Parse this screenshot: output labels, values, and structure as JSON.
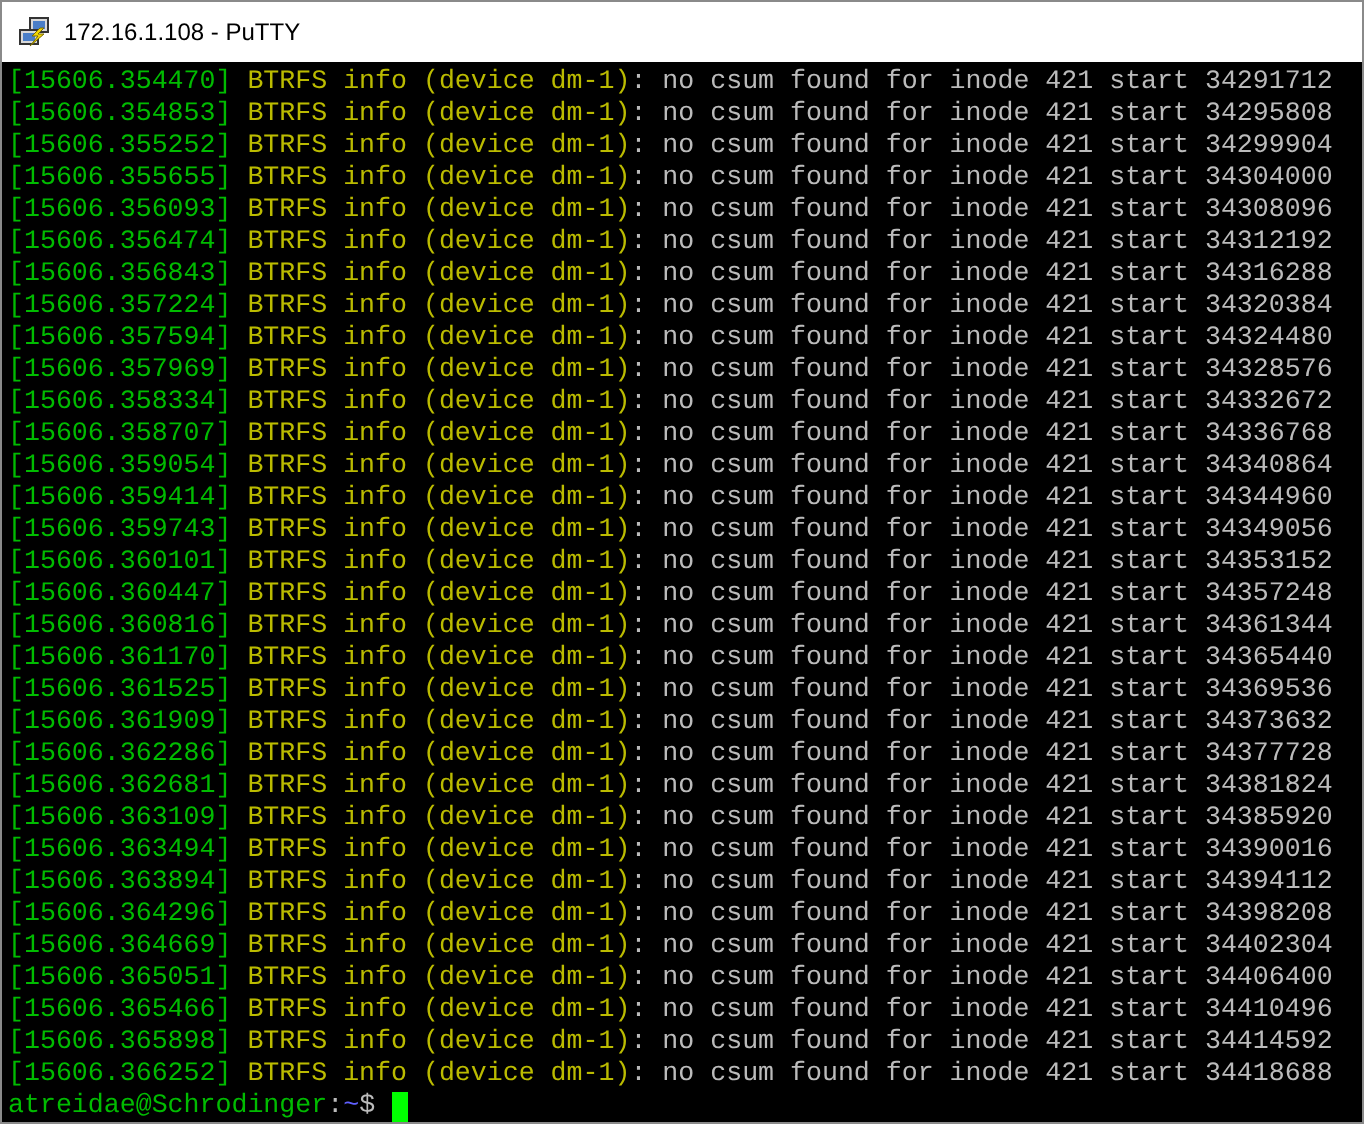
{
  "window": {
    "title": "172.16.1.108 - PuTTY"
  },
  "log_lines": [
    {
      "timestamp": "[15606.354470]",
      "source": "BTRFS info (device dm-1)",
      "message": ": no csum found for inode 421 start 34291712"
    },
    {
      "timestamp": "[15606.354853]",
      "source": "BTRFS info (device dm-1)",
      "message": ": no csum found for inode 421 start 34295808"
    },
    {
      "timestamp": "[15606.355252]",
      "source": "BTRFS info (device dm-1)",
      "message": ": no csum found for inode 421 start 34299904"
    },
    {
      "timestamp": "[15606.355655]",
      "source": "BTRFS info (device dm-1)",
      "message": ": no csum found for inode 421 start 34304000"
    },
    {
      "timestamp": "[15606.356093]",
      "source": "BTRFS info (device dm-1)",
      "message": ": no csum found for inode 421 start 34308096"
    },
    {
      "timestamp": "[15606.356474]",
      "source": "BTRFS info (device dm-1)",
      "message": ": no csum found for inode 421 start 34312192"
    },
    {
      "timestamp": "[15606.356843]",
      "source": "BTRFS info (device dm-1)",
      "message": ": no csum found for inode 421 start 34316288"
    },
    {
      "timestamp": "[15606.357224]",
      "source": "BTRFS info (device dm-1)",
      "message": ": no csum found for inode 421 start 34320384"
    },
    {
      "timestamp": "[15606.357594]",
      "source": "BTRFS info (device dm-1)",
      "message": ": no csum found for inode 421 start 34324480"
    },
    {
      "timestamp": "[15606.357969]",
      "source": "BTRFS info (device dm-1)",
      "message": ": no csum found for inode 421 start 34328576"
    },
    {
      "timestamp": "[15606.358334]",
      "source": "BTRFS info (device dm-1)",
      "message": ": no csum found for inode 421 start 34332672"
    },
    {
      "timestamp": "[15606.358707]",
      "source": "BTRFS info (device dm-1)",
      "message": ": no csum found for inode 421 start 34336768"
    },
    {
      "timestamp": "[15606.359054]",
      "source": "BTRFS info (device dm-1)",
      "message": ": no csum found for inode 421 start 34340864"
    },
    {
      "timestamp": "[15606.359414]",
      "source": "BTRFS info (device dm-1)",
      "message": ": no csum found for inode 421 start 34344960"
    },
    {
      "timestamp": "[15606.359743]",
      "source": "BTRFS info (device dm-1)",
      "message": ": no csum found for inode 421 start 34349056"
    },
    {
      "timestamp": "[15606.360101]",
      "source": "BTRFS info (device dm-1)",
      "message": ": no csum found for inode 421 start 34353152"
    },
    {
      "timestamp": "[15606.360447]",
      "source": "BTRFS info (device dm-1)",
      "message": ": no csum found for inode 421 start 34357248"
    },
    {
      "timestamp": "[15606.360816]",
      "source": "BTRFS info (device dm-1)",
      "message": ": no csum found for inode 421 start 34361344"
    },
    {
      "timestamp": "[15606.361170]",
      "source": "BTRFS info (device dm-1)",
      "message": ": no csum found for inode 421 start 34365440"
    },
    {
      "timestamp": "[15606.361525]",
      "source": "BTRFS info (device dm-1)",
      "message": ": no csum found for inode 421 start 34369536"
    },
    {
      "timestamp": "[15606.361909]",
      "source": "BTRFS info (device dm-1)",
      "message": ": no csum found for inode 421 start 34373632"
    },
    {
      "timestamp": "[15606.362286]",
      "source": "BTRFS info (device dm-1)",
      "message": ": no csum found for inode 421 start 34377728"
    },
    {
      "timestamp": "[15606.362681]",
      "source": "BTRFS info (device dm-1)",
      "message": ": no csum found for inode 421 start 34381824"
    },
    {
      "timestamp": "[15606.363109]",
      "source": "BTRFS info (device dm-1)",
      "message": ": no csum found for inode 421 start 34385920"
    },
    {
      "timestamp": "[15606.363494]",
      "source": "BTRFS info (device dm-1)",
      "message": ": no csum found for inode 421 start 34390016"
    },
    {
      "timestamp": "[15606.363894]",
      "source": "BTRFS info (device dm-1)",
      "message": ": no csum found for inode 421 start 34394112"
    },
    {
      "timestamp": "[15606.364296]",
      "source": "BTRFS info (device dm-1)",
      "message": ": no csum found for inode 421 start 34398208"
    },
    {
      "timestamp": "[15606.364669]",
      "source": "BTRFS info (device dm-1)",
      "message": ": no csum found for inode 421 start 34402304"
    },
    {
      "timestamp": "[15606.365051]",
      "source": "BTRFS info (device dm-1)",
      "message": ": no csum found for inode 421 start 34406400"
    },
    {
      "timestamp": "[15606.365466]",
      "source": "BTRFS info (device dm-1)",
      "message": ": no csum found for inode 421 start 34410496"
    },
    {
      "timestamp": "[15606.365898]",
      "source": "BTRFS info (device dm-1)",
      "message": ": no csum found for inode 421 start 34414592"
    },
    {
      "timestamp": "[15606.366252]",
      "source": "BTRFS info (device dm-1)",
      "message": ": no csum found for inode 421 start 34418688"
    }
  ],
  "prompt": {
    "user_host": "atreidae@Schrodinger",
    "separator": ":",
    "path": "~",
    "symbol": "$"
  }
}
